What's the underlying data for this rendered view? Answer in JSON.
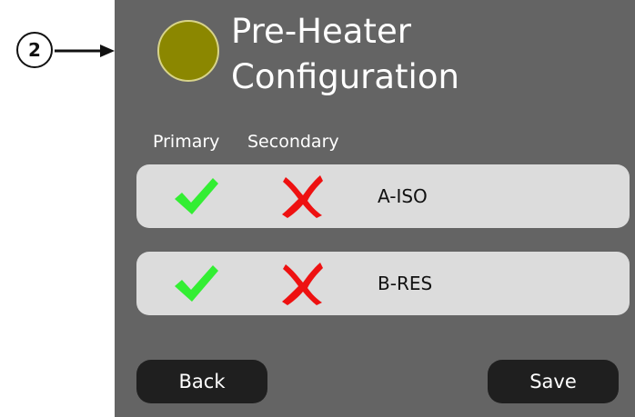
{
  "callout": {
    "number": "2"
  },
  "screen": {
    "title_line1": "Pre-Heater",
    "title_line2": "Configuration",
    "status_color": "#8b8700",
    "background_color": "#646464",
    "columns": {
      "primary": "Primary",
      "secondary": "Secondary"
    },
    "rows": [
      {
        "label": "A-ISO",
        "primary_icon": "check-icon",
        "secondary_icon": "cross-icon"
      },
      {
        "label": "B-RES",
        "primary_icon": "check-icon",
        "secondary_icon": "cross-icon"
      }
    ],
    "buttons": {
      "back": "Back",
      "save": "Save"
    }
  },
  "colors": {
    "check": "#33ee33",
    "cross": "#ee1111",
    "row_bg": "#dcdcdc",
    "button_bg": "#1f1f1f"
  }
}
